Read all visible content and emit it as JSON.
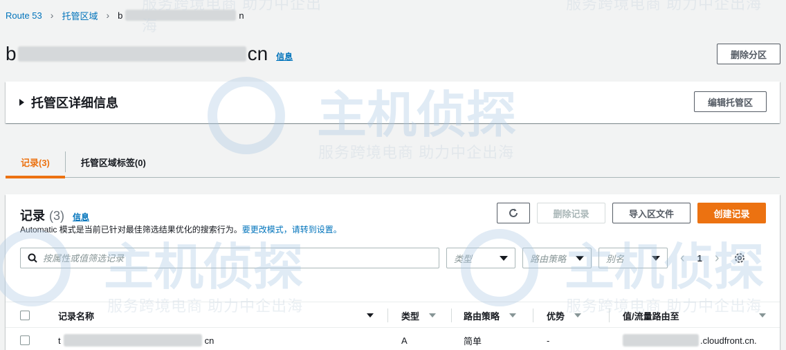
{
  "breadcrumb": {
    "root": "Route 53",
    "zones": "托管区域",
    "current_prefix": "b",
    "current_suffix": "n"
  },
  "page": {
    "title_prefix": "b",
    "title_suffix": "cn",
    "info": "信息",
    "delete_zone": "删除分区"
  },
  "details": {
    "title": "托管区详细信息",
    "edit_zone": "编辑托管区"
  },
  "tabs": [
    {
      "label": "记录(3)",
      "active": true
    },
    {
      "label": "托管区域标签(0)",
      "active": false
    }
  ],
  "records": {
    "title": "记录",
    "count": "(3)",
    "info": "信息",
    "desc_text": "Automatic 模式是当前已针对最佳筛选结果优化的搜索行为。",
    "desc_link1": "要更改模式，",
    "desc_link2": "请转到设置。",
    "delete_record": "删除记录",
    "import_zone_file": "导入区文件",
    "create_record": "创建记录",
    "search_placeholder": "按属性或值筛选记录",
    "filter_type": "类型",
    "filter_routing": "路由策略",
    "filter_alias": "别名",
    "page_number": "1"
  },
  "table": {
    "columns": [
      "记录名称",
      "类型",
      "路由策略",
      "优势",
      "值/流量路由至"
    ],
    "rows": [
      {
        "name_prefix": "t",
        "name_suffix": "cn",
        "type": "A",
        "routing": "简单",
        "advantage": "-",
        "value_suffix": ".cloudfront.cn."
      }
    ]
  },
  "watermark": {
    "brand": "主机侦探",
    "slogan": "服务跨境电商 助力中企出海"
  },
  "colors": {
    "accent": "#ec7211",
    "link": "#0073bb",
    "text": "#16191f",
    "background": "#f2f3f3"
  }
}
